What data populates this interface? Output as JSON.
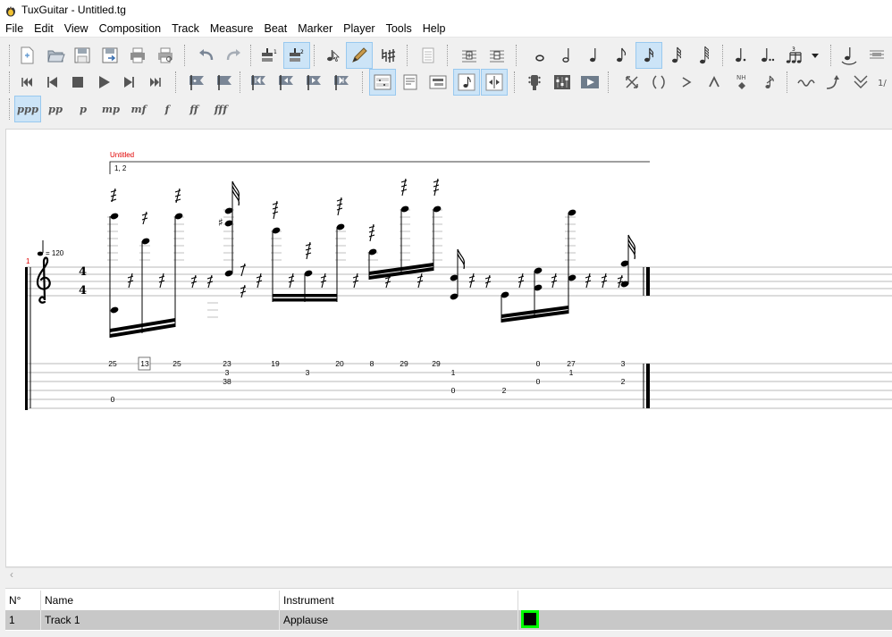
{
  "window": {
    "title": "TuxGuitar - Untitled.tg"
  },
  "menu": [
    "File",
    "Edit",
    "View",
    "Composition",
    "Track",
    "Measure",
    "Beat",
    "Marker",
    "Player",
    "Tools",
    "Help"
  ],
  "toolbar": {
    "dynamics": [
      "ppp",
      "pp",
      "p",
      "mp",
      "mf",
      "f",
      "ff",
      "fff"
    ],
    "active_dynamic": "ppp"
  },
  "score": {
    "song_title": "Untitled",
    "repeat_ending": "1, 2",
    "tempo": "= 120",
    "measure_number": "1",
    "time_signature": {
      "top": "4",
      "bottom": "4"
    },
    "tab_numbers": [
      {
        "text": "25",
        "string": 1
      },
      {
        "text": "13",
        "string": 1,
        "boxed": true
      },
      {
        "text": "25",
        "string": 1
      },
      {
        "text": "23",
        "string": 1
      },
      {
        "text": "3",
        "string": 2
      },
      {
        "text": "38",
        "string": 3
      },
      {
        "text": "19",
        "string": 1
      },
      {
        "text": "3",
        "string": 2
      },
      {
        "text": "20",
        "string": 1
      },
      {
        "text": "8",
        "string": 1
      },
      {
        "text": "29",
        "string": 1
      },
      {
        "text": "29",
        "string": 1
      },
      {
        "text": "1",
        "string": 2
      },
      {
        "text": "0",
        "string": 4
      },
      {
        "text": "2",
        "string": 4
      },
      {
        "text": "0",
        "string": 1
      },
      {
        "text": "0",
        "string": 3
      },
      {
        "text": "27",
        "string": 1
      },
      {
        "text": "1",
        "string": 2
      },
      {
        "text": "3",
        "string": 1
      },
      {
        "text": "2",
        "string": 3
      },
      {
        "text": "0",
        "string": 5
      }
    ]
  },
  "tracks": {
    "headers": {
      "number": "N°",
      "name": "Name",
      "instrument": "Instrument"
    },
    "rows": [
      {
        "number": "1",
        "name": "Track 1",
        "instrument": "Applause",
        "color": "#000000"
      }
    ]
  }
}
